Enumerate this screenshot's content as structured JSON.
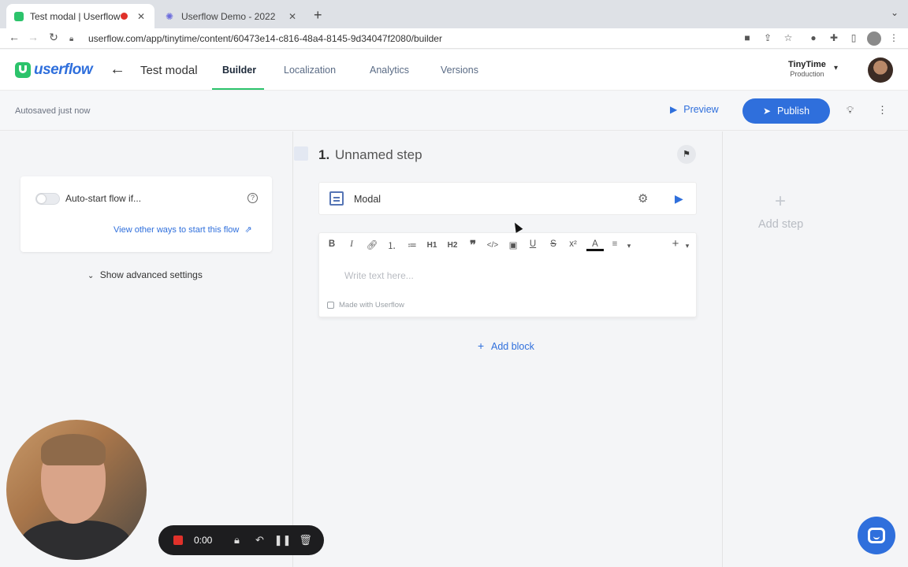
{
  "browser": {
    "tabs": [
      {
        "title": "Test modal | Userflow",
        "recording": true
      },
      {
        "title": "Userflow Demo - 2022"
      }
    ],
    "url": "userflow.com/app/tinytime/content/60473e14-c816-48a4-8145-9d34047f2080/builder"
  },
  "header": {
    "logo_text": "userflow",
    "flow_title": "Test modal",
    "tabs": [
      "Builder",
      "Localization",
      "Analytics",
      "Versions"
    ],
    "active_tab": "Builder",
    "org_name": "TinyTime",
    "org_env": "Production"
  },
  "subheader": {
    "autosave_status": "Autosaved just now",
    "preview_label": "Preview",
    "publish_label": "Publish"
  },
  "left_panel": {
    "autostart_label": "Auto-start flow if...",
    "autostart_enabled": false,
    "other_ways_link": "View other ways to start this flow",
    "advanced_toggle": "Show advanced settings"
  },
  "step": {
    "number": "1.",
    "name": "Unnamed step",
    "block_type": "Modal",
    "editor_placeholder": "Write text here...",
    "branding": "Made with Userflow",
    "add_block_label": "Add block",
    "toolbar_items": [
      "B",
      "I",
      "link",
      "ol",
      "ul",
      "H1",
      "H2",
      "quote",
      "code",
      "embed",
      "U",
      "S",
      "x²",
      "A",
      "align",
      "plus"
    ]
  },
  "right_panel": {
    "add_step_label": "Add step"
  },
  "recorder": {
    "time": "0:00"
  },
  "colors": {
    "brand_blue": "#2f6fdc",
    "brand_green": "#2cc36b",
    "record_red": "#e0312a"
  }
}
